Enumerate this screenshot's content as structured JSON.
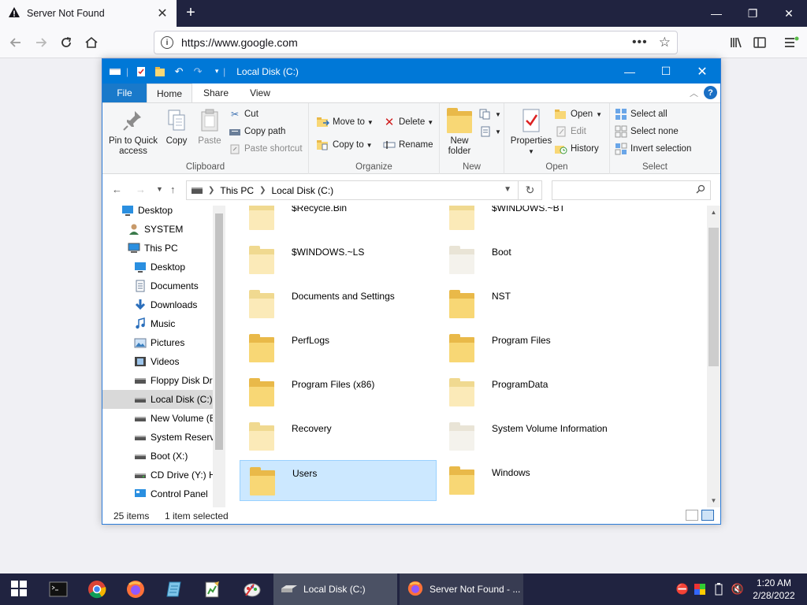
{
  "browser": {
    "tab_title": "Server Not Found",
    "url": "https://www.google.com"
  },
  "explorer": {
    "title": "Local Disk (C:)",
    "ribbon_tabs": [
      "File",
      "Home",
      "Share",
      "View"
    ],
    "clipboard": {
      "pin_label_1": "Pin to Quick",
      "pin_label_2": "access",
      "copy": "Copy",
      "paste": "Paste",
      "cut": "Cut",
      "copy_path": "Copy path",
      "paste_shortcut": "Paste shortcut",
      "group": "Clipboard"
    },
    "organize": {
      "move_to": "Move to",
      "copy_to": "Copy to",
      "delete": "Delete",
      "rename": "Rename",
      "group": "Organize"
    },
    "new": {
      "new_folder_1": "New",
      "new_folder_2": "folder",
      "group": "New"
    },
    "open": {
      "properties": "Properties",
      "open": "Open",
      "edit": "Edit",
      "history": "History",
      "group": "Open"
    },
    "select": {
      "select_all": "Select all",
      "select_none": "Select none",
      "invert": "Invert selection",
      "group": "Select"
    },
    "address": {
      "crumb1": "This PC",
      "crumb2": "Local Disk (C:)"
    },
    "nav_items": [
      {
        "label": "Desktop",
        "icon": "desktop-icon"
      },
      {
        "label": "SYSTEM",
        "icon": "user-icon"
      },
      {
        "label": "This PC",
        "icon": "computer-icon"
      },
      {
        "label": "Desktop",
        "icon": "desktop-icon"
      },
      {
        "label": "Documents",
        "icon": "documents-icon"
      },
      {
        "label": "Downloads",
        "icon": "downloads-icon"
      },
      {
        "label": "Music",
        "icon": "music-icon"
      },
      {
        "label": "Pictures",
        "icon": "pictures-icon"
      },
      {
        "label": "Videos",
        "icon": "videos-icon"
      },
      {
        "label": "Floppy Disk Dri",
        "icon": "floppy-icon"
      },
      {
        "label": "Local Disk (C:)",
        "icon": "drive-icon"
      },
      {
        "label": "New Volume (E",
        "icon": "drive-icon"
      },
      {
        "label": "System Reserve",
        "icon": "drive-icon"
      },
      {
        "label": "Boot (X:)",
        "icon": "drive-icon"
      },
      {
        "label": "CD Drive (Y:) H",
        "icon": "cd-drive-icon"
      },
      {
        "label": "Control Panel",
        "icon": "control-panel-icon"
      }
    ],
    "folders": [
      {
        "name": "$Recycle.Bin",
        "style": "faded"
      },
      {
        "name": "$WINDOWS.~BT",
        "style": "faded"
      },
      {
        "name": "$WINDOWS.~LS",
        "style": "faded"
      },
      {
        "name": "Boot",
        "style": "pale"
      },
      {
        "name": "Documents and Settings",
        "style": "faded"
      },
      {
        "name": "NST",
        "style": "normal"
      },
      {
        "name": "PerfLogs",
        "style": "normal"
      },
      {
        "name": "Program Files",
        "style": "normal"
      },
      {
        "name": "Program Files (x86)",
        "style": "normal"
      },
      {
        "name": "ProgramData",
        "style": "faded"
      },
      {
        "name": "Recovery",
        "style": "faded"
      },
      {
        "name": "System Volume Information",
        "style": "pale"
      },
      {
        "name": "Users",
        "style": "normal"
      },
      {
        "name": "Windows",
        "style": "normal"
      }
    ],
    "status": {
      "count": "25 items",
      "selected": "1 item selected"
    }
  },
  "taskbar": {
    "window1": "Local Disk (C:)",
    "window2": "Server Not Found - ...",
    "time": "1:20 AM",
    "date": "2/28/2022"
  }
}
